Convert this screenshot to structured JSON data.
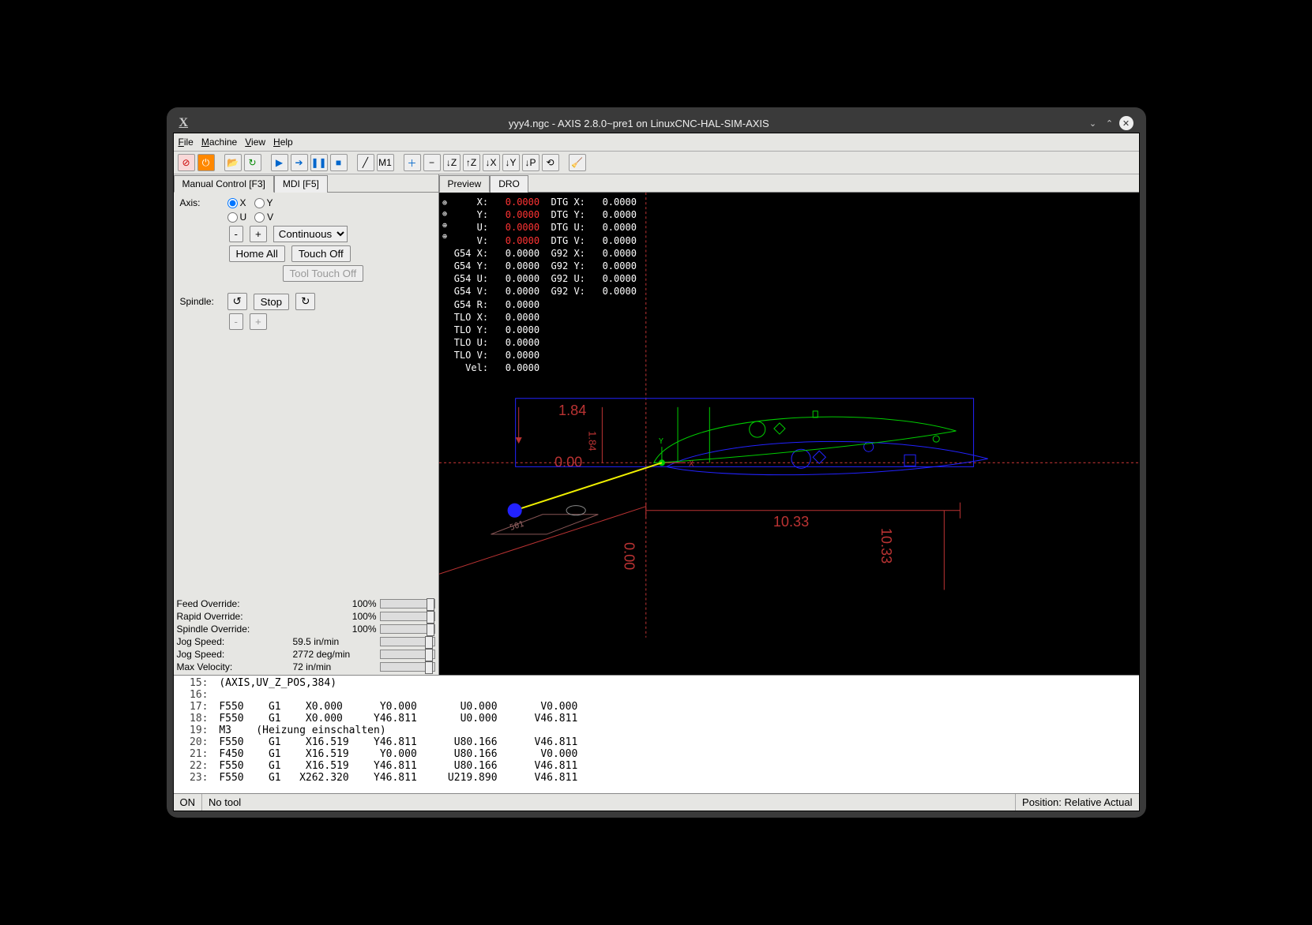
{
  "window": {
    "title": "yyy4.ngc - AXIS 2.8.0~pre1 on LinuxCNC-HAL-SIM-AXIS",
    "app_icon": "X"
  },
  "menu": {
    "file": "File",
    "machine": "Machine",
    "view": "View",
    "help": "Help"
  },
  "tabs": {
    "manual": "Manual Control [F3]",
    "mdi": "MDI [F5]",
    "preview": "Preview",
    "dro": "DRO"
  },
  "panel": {
    "axis_label": "Axis:",
    "axes": [
      "X",
      "Y",
      "U",
      "V"
    ],
    "minus": "-",
    "plus": "+",
    "jog_mode": "Continuous",
    "home_all": "Home All",
    "touch_off": "Touch Off",
    "tool_touch_off": "Tool Touch Off",
    "spindle_label": "Spindle:",
    "stop": "Stop",
    "ccw": "↺",
    "cw": "↻",
    "sp_minus": "-",
    "sp_plus": "+"
  },
  "overrides": {
    "feed": {
      "label": "Feed Override:",
      "value": "100%",
      "pos": 60
    },
    "rapid": {
      "label": "Rapid Override:",
      "value": "100%",
      "pos": 60
    },
    "spindle": {
      "label": "Spindle Override:",
      "value": "100%",
      "pos": 60
    },
    "jog1": {
      "label": "Jog Speed:",
      "value": "59.5 in/min",
      "pos": 58
    },
    "jog2": {
      "label": "Jog Speed:",
      "value": "2772 deg/min",
      "pos": 58
    },
    "maxv": {
      "label": "Max Velocity:",
      "value": "72 in/min",
      "pos": 58
    }
  },
  "dro": {
    "rows": [
      [
        "     X:",
        "0.0000",
        "DTG X:",
        "0.0000"
      ],
      [
        "     Y:",
        "0.0000",
        "DTG Y:",
        "0.0000"
      ],
      [
        "     U:",
        "0.0000",
        "DTG U:",
        "0.0000"
      ],
      [
        "     V:",
        "0.0000",
        "DTG V:",
        "0.0000"
      ],
      [
        " G54 X:",
        "0.0000",
        "G92 X:",
        "0.0000"
      ],
      [
        " G54 Y:",
        "0.0000",
        "G92 Y:",
        "0.0000"
      ],
      [
        " G54 U:",
        "0.0000",
        "G92 U:",
        "0.0000"
      ],
      [
        " G54 V:",
        "0.0000",
        "G92 V:",
        "0.0000"
      ],
      [
        " G54 R:",
        "0.0000",
        "",
        ""
      ],
      [
        " TLO X:",
        "0.0000",
        "",
        ""
      ],
      [
        " TLO Y:",
        "0.0000",
        "",
        ""
      ],
      [
        " TLO U:",
        "0.0000",
        "",
        ""
      ],
      [
        " TLO V:",
        "0.0000",
        "",
        ""
      ],
      [
        "   Vel:",
        "0.0000",
        "",
        ""
      ]
    ],
    "dims": {
      "h_val": "10.33",
      "h_zero": "0.00",
      "v_val": "1.84",
      "v_zero": "0.00",
      "r_val": "10.33"
    }
  },
  "gcode": [
    {
      "n": "15",
      "t": "(AXIS,UV_Z_POS,384)"
    },
    {
      "n": "16",
      "t": ""
    },
    {
      "n": "17",
      "t": "F550    G1    X0.000      Y0.000       U0.000       V0.000"
    },
    {
      "n": "18",
      "t": "F550    G1    X0.000     Y46.811       U0.000      V46.811"
    },
    {
      "n": "19",
      "t": "M3    (Heizung einschalten)"
    },
    {
      "n": "20",
      "t": "F550    G1    X16.519    Y46.811      U80.166      V46.811"
    },
    {
      "n": "21",
      "t": "F450    G1    X16.519     Y0.000      U80.166       V0.000"
    },
    {
      "n": "22",
      "t": "F550    G1    X16.519    Y46.811      U80.166      V46.811"
    },
    {
      "n": "23",
      "t": "F550    G1   X262.320    Y46.811     U219.890      V46.811"
    }
  ],
  "status": {
    "on": "ON",
    "tool": "No tool",
    "pos": "Position: Relative Actual"
  }
}
